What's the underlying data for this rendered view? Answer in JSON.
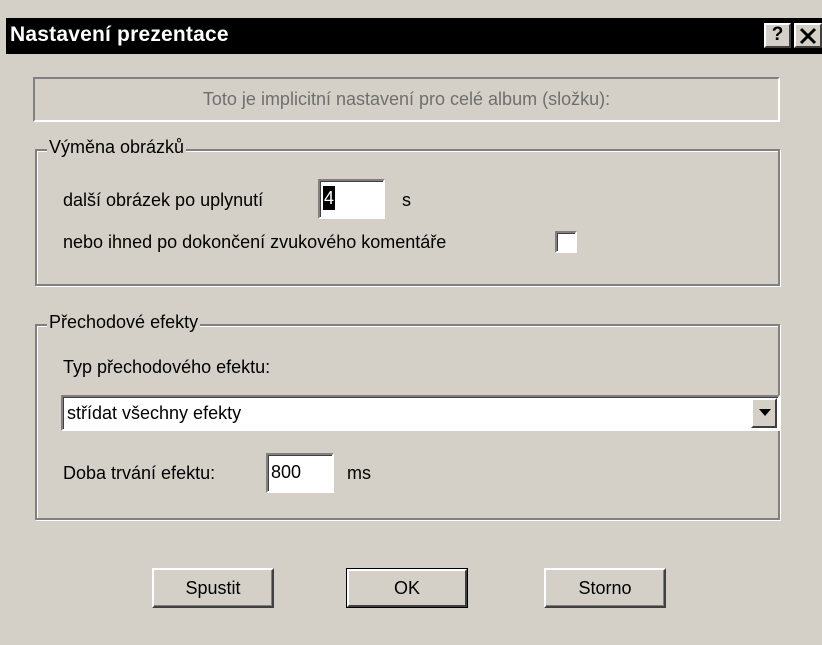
{
  "window": {
    "title": "Nastavení prezentace",
    "help_label": "?",
    "close_label": "✕"
  },
  "info": {
    "text": "Toto je implicitní nastavení pro celé album (složku):"
  },
  "image_change": {
    "legend": "Výměna obrázků",
    "next_label": "další obrázek po uplynutí",
    "next_value": "4",
    "next_unit": "s",
    "after_comment_label": "nebo ihned po dokončení zvukového komentáře",
    "after_comment_checked": false
  },
  "transitions": {
    "legend": "Přechodové efekty",
    "type_label": "Typ přechodového efektu:",
    "type_value": "střídat všechny efekty",
    "duration_label": "Doba trvání efektu:",
    "duration_value": "800",
    "duration_unit": "ms"
  },
  "buttons": {
    "start": "Spustit",
    "ok": "OK",
    "cancel": "Storno"
  }
}
